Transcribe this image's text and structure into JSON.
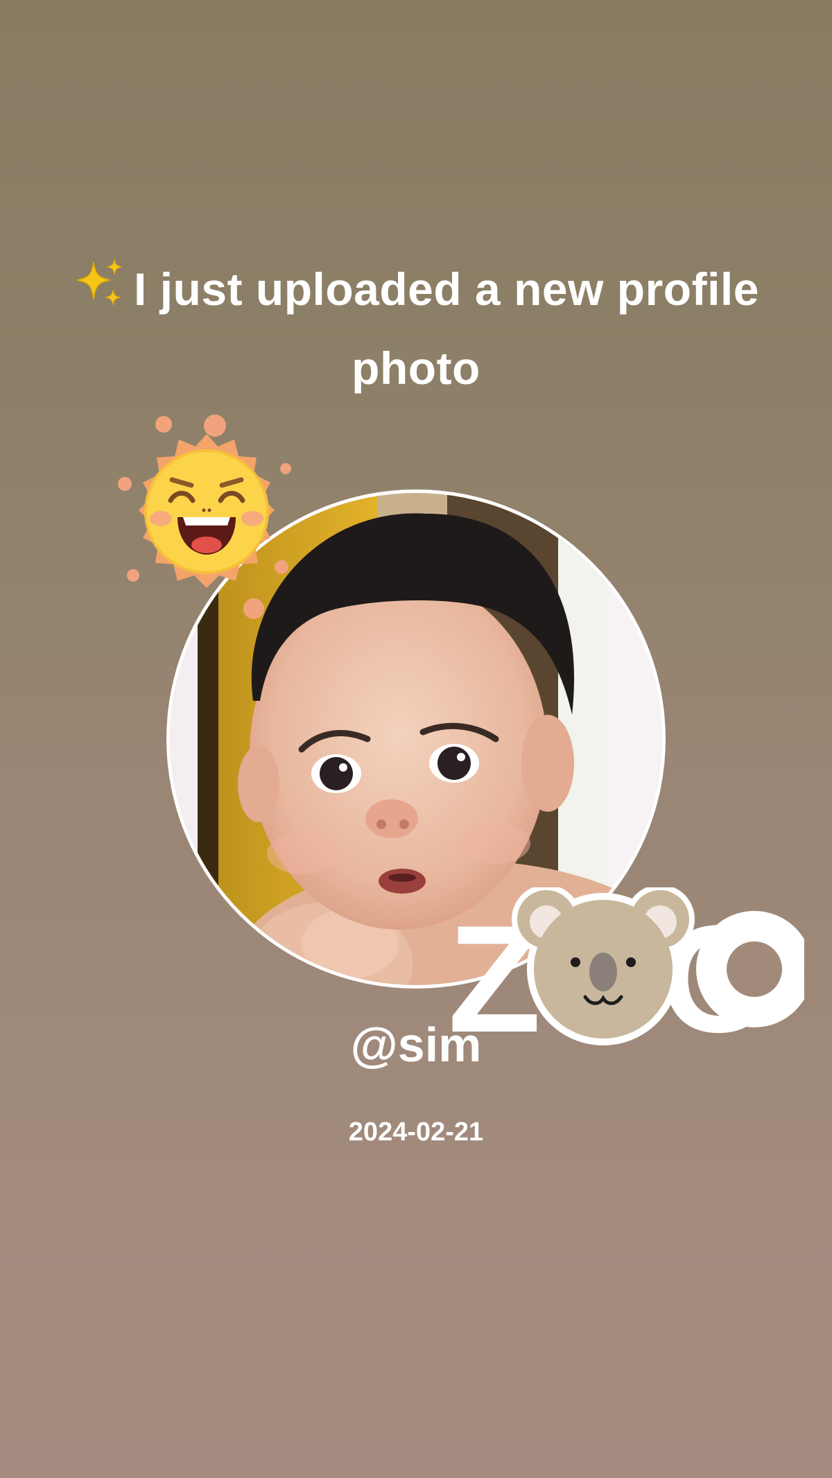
{
  "post": {
    "headline": "I just uploaded a new profile photo",
    "handle": "@sim",
    "date": "2024-02-21"
  },
  "stickers": {
    "top_left": "laughing-sun-icon",
    "bottom_right": "zoo-koala-sticker",
    "bottom_right_text": "ZOO"
  },
  "icons": {
    "headline_prefix": "sparkles-icon"
  },
  "colors": {
    "background_top": "#877b62",
    "background_bottom": "#a48b7f",
    "text": "#ffffff",
    "avatar_ring": "#ffffff"
  }
}
